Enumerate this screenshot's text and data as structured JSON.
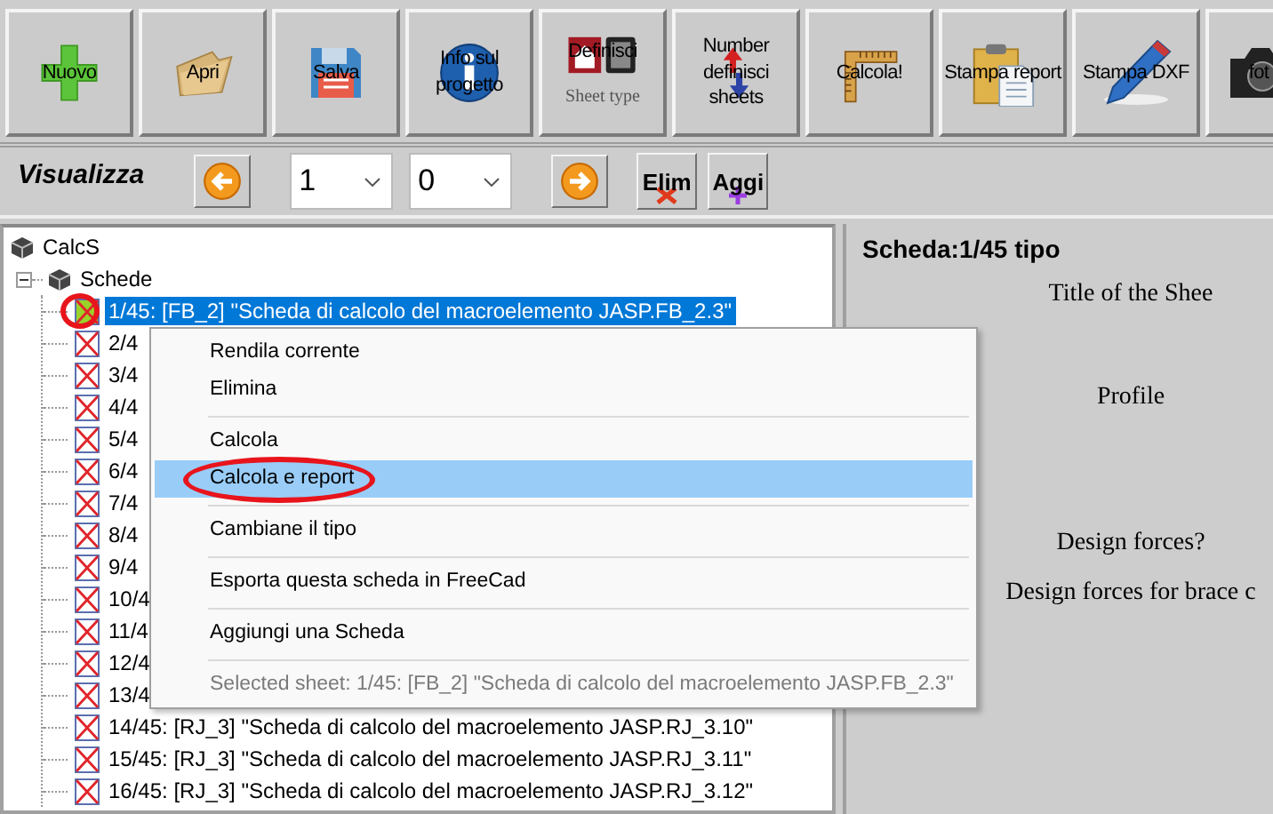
{
  "toolbar": {
    "buttons": [
      {
        "label": "Nuovo"
      },
      {
        "label": "Apri"
      },
      {
        "label": "Salva"
      },
      {
        "label": "Info sul progetto"
      },
      {
        "label": "Definisci",
        "sublabel": "Sheet type"
      },
      {
        "label": "Number definisci sheets"
      },
      {
        "label": "Calcola!"
      },
      {
        "label": "Stampa report"
      },
      {
        "label": "Stampa DXF"
      },
      {
        "label": "fot"
      }
    ]
  },
  "navigator": {
    "title": "Visualizza",
    "selects": [
      {
        "value": "1"
      },
      {
        "value": "0"
      }
    ],
    "buttons": [
      {
        "kind": "prev"
      },
      {
        "kind": "next"
      },
      {
        "kind": "delete",
        "label": "Elim"
      },
      {
        "kind": "add",
        "label": "Aggi"
      }
    ]
  },
  "tree": {
    "root": {
      "label": "CalcS",
      "children": [
        {
          "label": "Schede",
          "expanded": true,
          "children": [
            {
              "label": "1/45: [FB_2] \"Scheda di calcolo del macroelemento JASP.FB_2.3\"",
              "selected": true,
              "current": true,
              "circled": true
            },
            {
              "label": "2/4",
              "selected": false,
              "current": false,
              "circled": false
            },
            {
              "label": "3/4",
              "selected": false,
              "current": false,
              "circled": false
            },
            {
              "label": "4/4",
              "selected": false,
              "current": false,
              "circled": false
            },
            {
              "label": "5/4",
              "selected": false,
              "current": false,
              "circled": false
            },
            {
              "label": "6/4",
              "selected": false,
              "current": false,
              "circled": false
            },
            {
              "label": "7/4",
              "selected": false,
              "current": false,
              "circled": false
            },
            {
              "label": "8/4",
              "selected": false,
              "current": false,
              "circled": false
            },
            {
              "label": "9/4",
              "selected": false,
              "current": false,
              "circled": false
            },
            {
              "label": "10/4",
              "selected": false,
              "current": false,
              "circled": false
            },
            {
              "label": "11/4",
              "selected": false,
              "current": false,
              "circled": false
            },
            {
              "label": "12/4",
              "selected": false,
              "current": false,
              "circled": false
            },
            {
              "label": "13/4",
              "selected": false,
              "current": false,
              "circled": false
            },
            {
              "label": "14/45: [RJ_3] \"Scheda di calcolo del macroelemento JASP.RJ_3.10\"",
              "selected": false,
              "current": false,
              "circled": false
            },
            {
              "label": "15/45: [RJ_3] \"Scheda di calcolo del macroelemento JASP.RJ_3.11\"",
              "selected": false,
              "current": false,
              "circled": false
            },
            {
              "label": "16/45: [RJ_3] \"Scheda di calcolo del macroelemento JASP.RJ_3.12\"",
              "selected": false,
              "current": false,
              "circled": false
            }
          ]
        }
      ]
    }
  },
  "context_menu": {
    "items": [
      {
        "kind": "item",
        "label": "Rendila corrente",
        "selected": false,
        "disabled": false,
        "circled": false
      },
      {
        "kind": "item",
        "label": "Elimina",
        "selected": false,
        "disabled": false,
        "circled": false
      },
      {
        "kind": "separator"
      },
      {
        "kind": "item",
        "label": "Calcola",
        "selected": false,
        "disabled": false,
        "circled": false
      },
      {
        "kind": "item",
        "label": "Calcola e report",
        "selected": true,
        "disabled": false,
        "circled": true
      },
      {
        "kind": "separator"
      },
      {
        "kind": "item",
        "label": "Cambiane il tipo",
        "selected": false,
        "disabled": false,
        "circled": false
      },
      {
        "kind": "separator"
      },
      {
        "kind": "item",
        "label": "Esporta questa scheda in FreeCad",
        "selected": false,
        "disabled": false,
        "circled": false
      },
      {
        "kind": "separator"
      },
      {
        "kind": "item",
        "label": "Aggiungi una Scheda",
        "selected": false,
        "disabled": false,
        "circled": false
      },
      {
        "kind": "separator"
      },
      {
        "kind": "item",
        "label": "Selected sheet: 1/45: [FB_2] \"Scheda di calcolo del macroelemento JASP.FB_2.3\"",
        "selected": false,
        "disabled": true,
        "circled": false
      }
    ]
  },
  "preview": {
    "heading": "Scheda:1/45 tipo",
    "lines": [
      "Title of the Shee",
      "Profile",
      "Design forces?",
      "Design forces for brace c"
    ]
  }
}
